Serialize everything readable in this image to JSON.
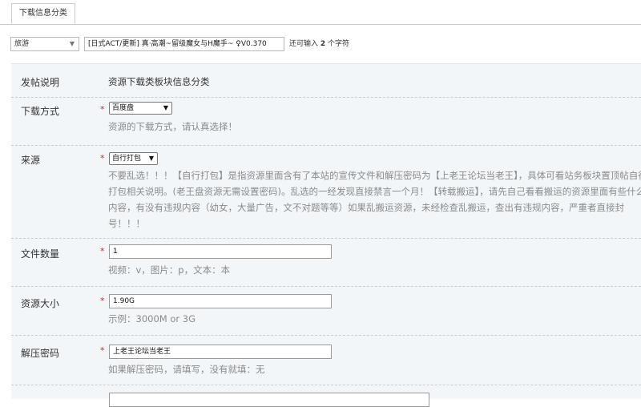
{
  "tab": {
    "label": "下载信息分类"
  },
  "typebar": {
    "type_value": "旅游",
    "title_value": "[日式ACT/更新] 真·高潮~留级魔女与H魔手~ ♀V0.370",
    "remain_prefix": "还可输入",
    "remain_count": "2",
    "remain_suffix": "个字符"
  },
  "form": {
    "intro": {
      "label": "发帖说明",
      "value": "资源下载类板块信息分类"
    },
    "download_method": {
      "label": "下载方式",
      "required": "*",
      "selected": "百度盘",
      "hint": "资源的下载方式，请认真选择！"
    },
    "source": {
      "label": "来源",
      "required": "*",
      "selected": "自行打包",
      "hint": "不要乱选！！！【自行打包】是指资源里面含有了本站的宣传文件和解压密码为【上老王论坛当老王】，具体可看站务板块置顶帖自行打包相关说明。(老王盘资源无需设置密码)。乱选的一经发现直接禁言一个月！【转载搬运】，请先自己看看搬运的资源里面有些什么内容，有没有违规内容（幼女，大量广告，文不对题等等）如果乱搬运资源，未经检查乱搬运，查出有违规内容，严重者直接封号！！！"
    },
    "file_count": {
      "label": "文件数量",
      "required": "*",
      "value": "1",
      "hint": "视频：v，图片：p，文本：本"
    },
    "size": {
      "label": "资源大小",
      "required": "*",
      "value": "1.90G",
      "hint": "示例：3000M or 3G"
    },
    "password": {
      "label": "解压密码",
      "required": "*",
      "value": "上老王论坛当老王",
      "hint": "如果解压密码，请填写，没有就填：无"
    }
  },
  "icons": {
    "select_chevron": "chevron-down-icon"
  }
}
